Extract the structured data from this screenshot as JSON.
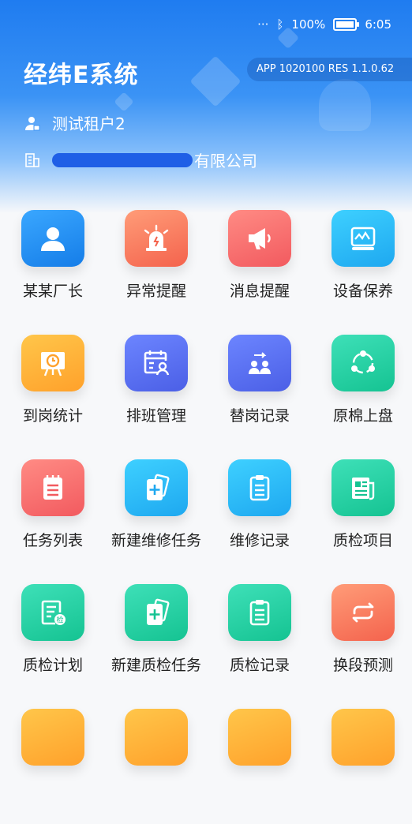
{
  "status_bar": {
    "dots": "···",
    "battery": "100%",
    "time": "6:05"
  },
  "header": {
    "app_title": "经纬E系统",
    "version": "APP 1020100   RES 1.1.0.62",
    "tenant": "测试租户2",
    "company": "有限公司"
  },
  "menu": {
    "items": [
      {
        "label": "某某厂长",
        "icon": "person-icon",
        "color": "#1f8cf4"
      },
      {
        "label": "异常提醒",
        "icon": "alarm-light-icon",
        "color": "#f77a5d"
      },
      {
        "label": "消息提醒",
        "icon": "megaphone-icon",
        "color": "#f56f6e"
      },
      {
        "label": "设备保养",
        "icon": "monitor-device-icon",
        "color": "#2dbcf6"
      },
      {
        "label": "到岗统计",
        "icon": "presentation-clock-icon",
        "color": "#ffb33a"
      },
      {
        "label": "排班管理",
        "icon": "schedule-person-icon",
        "color": "#5b72f2"
      },
      {
        "label": "替岗记录",
        "icon": "swap-people-icon",
        "color": "#5b72f2"
      },
      {
        "label": "原棉上盘",
        "icon": "cycle-nodes-icon",
        "color": "#22d1a4"
      },
      {
        "label": "任务列表",
        "icon": "clipboard-list-icon",
        "color": "#f56f6e"
      },
      {
        "label": "新建维修任务",
        "icon": "new-card-plus-icon",
        "color": "#2dbcf6"
      },
      {
        "label": "维修记录",
        "icon": "clipboard-record-icon",
        "color": "#2dbcf6"
      },
      {
        "label": "质检项目",
        "icon": "newspaper-icon",
        "color": "#22d1a4"
      },
      {
        "label": "质检计划",
        "icon": "inspection-plan-icon",
        "color": "#22d1a4"
      },
      {
        "label": "新建质检任务",
        "icon": "new-card-plus-icon",
        "color": "#22d1a4"
      },
      {
        "label": "质检记录",
        "icon": "clipboard-record-icon",
        "color": "#22d1a4"
      },
      {
        "label": "换段预测",
        "icon": "swap-arrows-icon",
        "color": "#f77a5d"
      }
    ]
  }
}
